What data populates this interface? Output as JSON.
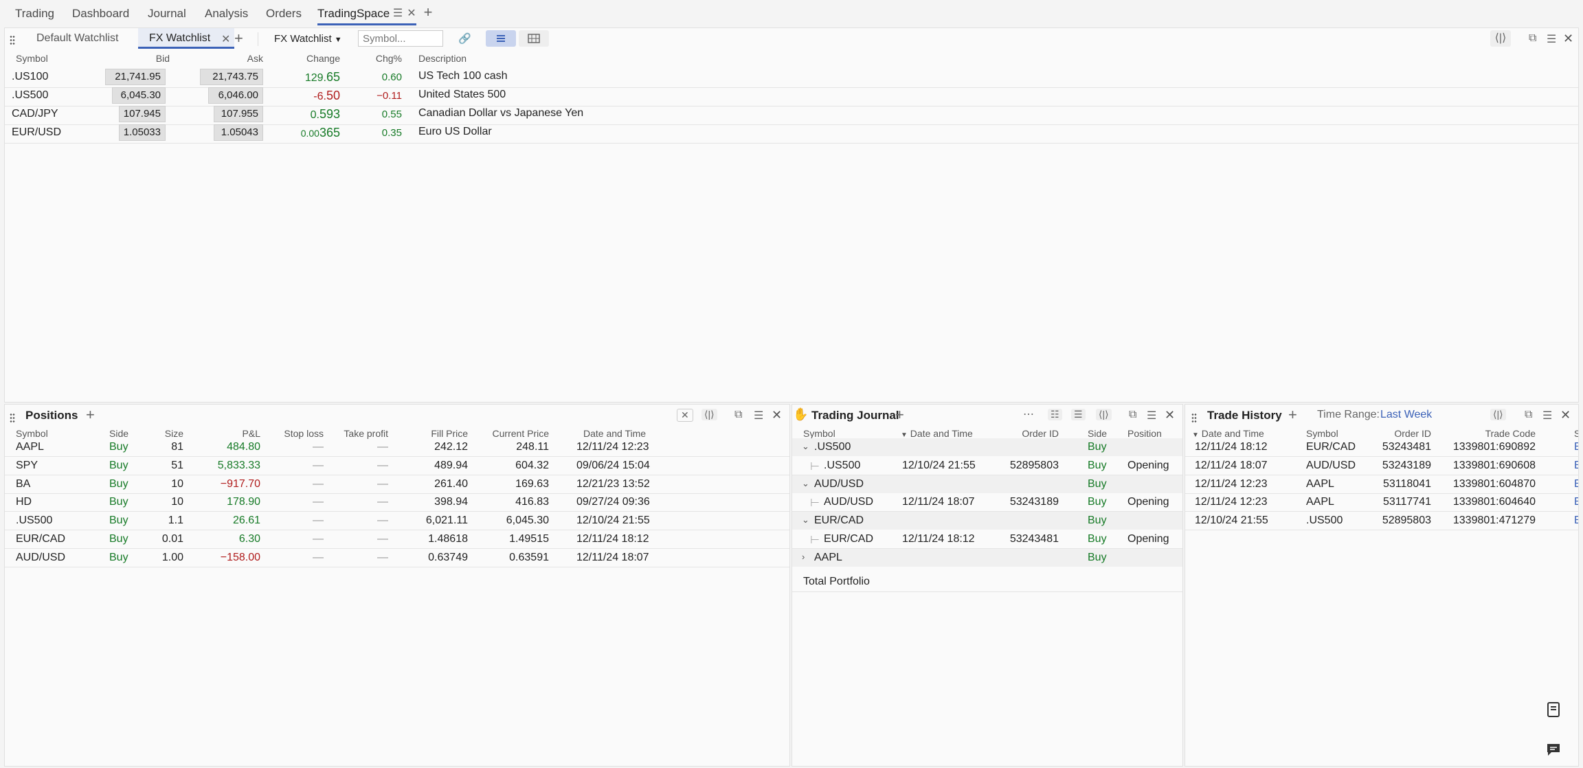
{
  "top_tabs": [
    "Trading",
    "Dashboard",
    "Journal",
    "Analysis",
    "Orders",
    "TradingSpace"
  ],
  "watchlist": {
    "tabs": [
      "Default Watchlist",
      "FX Watchlist"
    ],
    "selector": "FX Watchlist",
    "symbol_placeholder": "Symbol...",
    "headers": [
      "Symbol",
      "Bid",
      "Ask",
      "Change",
      "Chg%",
      "Description"
    ],
    "rows": [
      {
        "symbol": ".US100",
        "bid": "21,741.95",
        "ask": "21,743.75",
        "change_a": "129.",
        "change_b": "65",
        "chg": "0.60",
        "desc": "US Tech 100 cash",
        "dir": "up"
      },
      {
        "symbol": ".US500",
        "bid": "6,045.30",
        "ask": "6,046.00",
        "change_a": "-6.",
        "change_b": "50",
        "chg": "−0.11",
        "desc": "United States 500",
        "dir": "down"
      },
      {
        "symbol": "CAD/JPY",
        "bid": "107.945",
        "ask": "107.955",
        "change_a": "0.",
        "change_b": "593",
        "chg": "0.55",
        "desc": "Canadian Dollar vs Japanese Yen",
        "dir": "up"
      },
      {
        "symbol": "EUR/USD",
        "bid": "1.05033",
        "ask": "1.05043",
        "change_a": "0.00",
        "change_b": "365",
        "chg": "0.35",
        "desc": "Euro US Dollar",
        "dir": "up"
      }
    ]
  },
  "positions": {
    "title": "Positions",
    "headers": [
      "Symbol",
      "Side",
      "Size",
      "P&L",
      "Stop loss",
      "Take profit",
      "Fill Price",
      "Current Price",
      "Date and Time"
    ],
    "rows": [
      {
        "symbol": "AAPL",
        "side": "Buy",
        "size": "81",
        "pnl": "484.80",
        "sl": "—",
        "tp": "—",
        "fill": "242.12",
        "current": "248.11",
        "dt": "12/11/24 12:23",
        "dir": "up"
      },
      {
        "symbol": "SPY",
        "side": "Buy",
        "size": "51",
        "pnl": "5,833.33",
        "sl": "—",
        "tp": "—",
        "fill": "489.94",
        "current": "604.32",
        "dt": "09/06/24 15:04",
        "dir": "up"
      },
      {
        "symbol": "BA",
        "side": "Buy",
        "size": "10",
        "pnl": "−917.70",
        "sl": "—",
        "tp": "—",
        "fill": "261.40",
        "current": "169.63",
        "dt": "12/21/23 13:52",
        "dir": "down"
      },
      {
        "symbol": "HD",
        "side": "Buy",
        "size": "10",
        "pnl": "178.90",
        "sl": "—",
        "tp": "—",
        "fill": "398.94",
        "current": "416.83",
        "dt": "09/27/24 09:36",
        "dir": "up"
      },
      {
        "symbol": ".US500",
        "side": "Buy",
        "size": "1.1",
        "pnl": "26.61",
        "sl": "—",
        "tp": "—",
        "fill": "6,021.11",
        "current": "6,045.30",
        "dt": "12/10/24 21:55",
        "dir": "up"
      },
      {
        "symbol": "EUR/CAD",
        "side": "Buy",
        "size": "0.01",
        "pnl": "6.30",
        "sl": "—",
        "tp": "—",
        "fill": "1.48618",
        "current": "1.49515",
        "dt": "12/11/24 18:12",
        "dir": "up"
      },
      {
        "symbol": "AUD/USD",
        "side": "Buy",
        "size": "1.00",
        "pnl": "−158.00",
        "sl": "—",
        "tp": "—",
        "fill": "0.63749",
        "current": "0.63591",
        "dt": "12/11/24 18:07",
        "dir": "down"
      }
    ]
  },
  "journal": {
    "title": "Trading Journal",
    "headers": [
      "Symbol",
      "Date and Time",
      "Order ID",
      "Side",
      "Position effec"
    ],
    "rows": [
      {
        "group": true,
        "open": true,
        "symbol": ".US500",
        "dt": "",
        "oid": "",
        "side": "Buy",
        "effect": ""
      },
      {
        "group": false,
        "symbol": ".US500",
        "dt": "12/10/24 21:55",
        "oid": "52895803",
        "side": "Buy",
        "effect": "Opening"
      },
      {
        "group": true,
        "open": true,
        "symbol": "AUD/USD",
        "dt": "",
        "oid": "",
        "side": "Buy",
        "effect": ""
      },
      {
        "group": false,
        "symbol": "AUD/USD",
        "dt": "12/11/24 18:07",
        "oid": "53243189",
        "side": "Buy",
        "effect": "Opening"
      },
      {
        "group": true,
        "open": true,
        "symbol": "EUR/CAD",
        "dt": "",
        "oid": "",
        "side": "Buy",
        "effect": ""
      },
      {
        "group": false,
        "symbol": "EUR/CAD",
        "dt": "12/11/24 18:12",
        "oid": "53243481",
        "side": "Buy",
        "effect": "Opening"
      },
      {
        "group": true,
        "open": false,
        "symbol": "AAPL",
        "dt": "",
        "oid": "",
        "side": "Buy",
        "effect": ""
      }
    ],
    "total_label": "Total Portfolio"
  },
  "history": {
    "title": "Trade History",
    "time_range_label": "Time Range:",
    "time_range_value": "Last Week",
    "headers": [
      "Date and Time",
      "Symbol",
      "Order ID",
      "Trade Code",
      "S"
    ],
    "rows": [
      {
        "dt": "12/11/24 18:12",
        "symbol": "EUR/CAD",
        "oid": "53243481",
        "code": "1339801:690892",
        "s": "E"
      },
      {
        "dt": "12/11/24 18:07",
        "symbol": "AUD/USD",
        "oid": "53243189",
        "code": "1339801:690608",
        "s": "E"
      },
      {
        "dt": "12/11/24 12:23",
        "symbol": "AAPL",
        "oid": "53118041",
        "code": "1339801:604870",
        "s": "E"
      },
      {
        "dt": "12/11/24 12:23",
        "symbol": "AAPL",
        "oid": "53117741",
        "code": "1339801:604640",
        "s": "E"
      },
      {
        "dt": "12/10/24 21:55",
        "symbol": ".US500",
        "oid": "52895803",
        "code": "1339801:471279",
        "s": "E"
      }
    ]
  },
  "colors": {
    "accent": "#3b61b7",
    "up": "#167a26",
    "down": "#b01c1c"
  }
}
